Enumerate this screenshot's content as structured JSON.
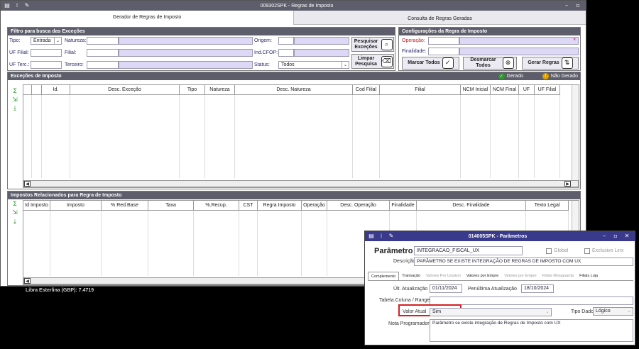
{
  "main": {
    "title": "009302SPK - Regras de Imposto",
    "tabs": [
      "Gerador de Regras de Imposto",
      "Consulta de Regras Geradas"
    ],
    "filter": {
      "title": "Filtro para busca das Exceções",
      "tipo_label": "Tipo:",
      "tipo_value": "Entrada",
      "natureza_label": "Natureza:",
      "origem_label": "Origem:",
      "uf_filial_label": "UF Filial:",
      "filial_label": "Filial:",
      "ind_cfop_label": "Ind.CFOP:",
      "uf_terc_label": "UF Terc.:",
      "terceiro_label": "Terceiro:",
      "status_label": "Status:",
      "status_value": "Todos",
      "pesquisar_label": "Pesquisar Exceções",
      "limpar_label": "Limpar Pesquisa"
    },
    "config": {
      "title": "Configurações da Regra de Imposto",
      "operacao_label": "Operação:",
      "finalidade_label": "Finalidade:",
      "marcar_label": "Marcar Todos",
      "desmarcar_label": "Desmarcar Todos",
      "gerar_label": "Gerar Regras"
    },
    "excecoes": {
      "title": "Exceções de Imposto",
      "legend_gerado": "Gerado",
      "legend_nao_gerado": "Não Gerado",
      "columns": [
        "Id.",
        "Desc. Exceção",
        "Tipo",
        "Natureza",
        "Desc. Natureza",
        "Cod Filial",
        "Filial",
        "NCM Inicial",
        "NCM Final",
        "UF",
        "UF Filial"
      ]
    },
    "impostos": {
      "title": "Impostos Relacionados para Regra de Imposto",
      "columns": [
        "Id Imposto",
        "Imposto",
        "% Red.Base",
        "Taxa",
        "%.Recup.",
        "CST",
        "Regra Imposto",
        "Operação",
        "Desc. Operação",
        "Finalidade",
        "Desc. Finalidade",
        "Texto Legal"
      ]
    },
    "status_text": "Libra Esterlina (GBP): 7.4719"
  },
  "dialog": {
    "title": "014005SPK - Parâmetros",
    "parametro_label": "Parâmetro",
    "parametro_value": "INTEGRACAO_FISCAL_UX",
    "global_label": "Global",
    "exclusivo_label": "Exclusivo Linx",
    "descricao_label": "Descrição",
    "descricao_value": "PARÂMETRO SE EXISTE INTEGRAÇÃO DE REGRAS DE IMPOSTO COM UX",
    "tabs": [
      "Complemento",
      "Transação",
      "Valores Por Usuário",
      "Valores por Empre",
      "Valores por Empre",
      "Filiais Retaguarda",
      "Filiais Loja"
    ],
    "ult_label": "Últ. Atualização",
    "ult_value": "01/11/2024",
    "pen_label": "Penúltima Atualização",
    "pen_value": "18/10/2024",
    "tabela_label": "Tabela.Coluna / Range",
    "valor_label": "Valor Atual",
    "valor_value": "Sim",
    "tipo_label": "Tipo Dado",
    "tipo_value": "Lógico",
    "nota_label": "Nota Programador",
    "nota_value": "Parâmetro se existe integração de Regras de Imposto com UX"
  },
  "colors": {
    "titlebar": "#5d5d6b",
    "dialog_titlebar": "#3a3a8c",
    "highlight": "#d42020",
    "lavender": "#dcd8f5"
  }
}
